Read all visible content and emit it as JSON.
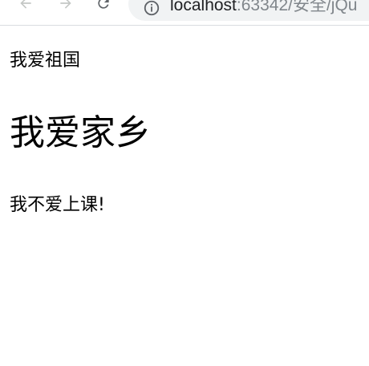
{
  "browser": {
    "url_host": "localhost",
    "url_rest": ":63342/安全/jQu",
    "icons": {
      "back": "back-arrow-icon",
      "forward": "forward-arrow-icon",
      "reload": "reload-icon",
      "site_info": "info-icon"
    }
  },
  "page": {
    "line1": "我爱祖国",
    "heading": "我爱家乡",
    "line3": "我不爱上课!"
  }
}
